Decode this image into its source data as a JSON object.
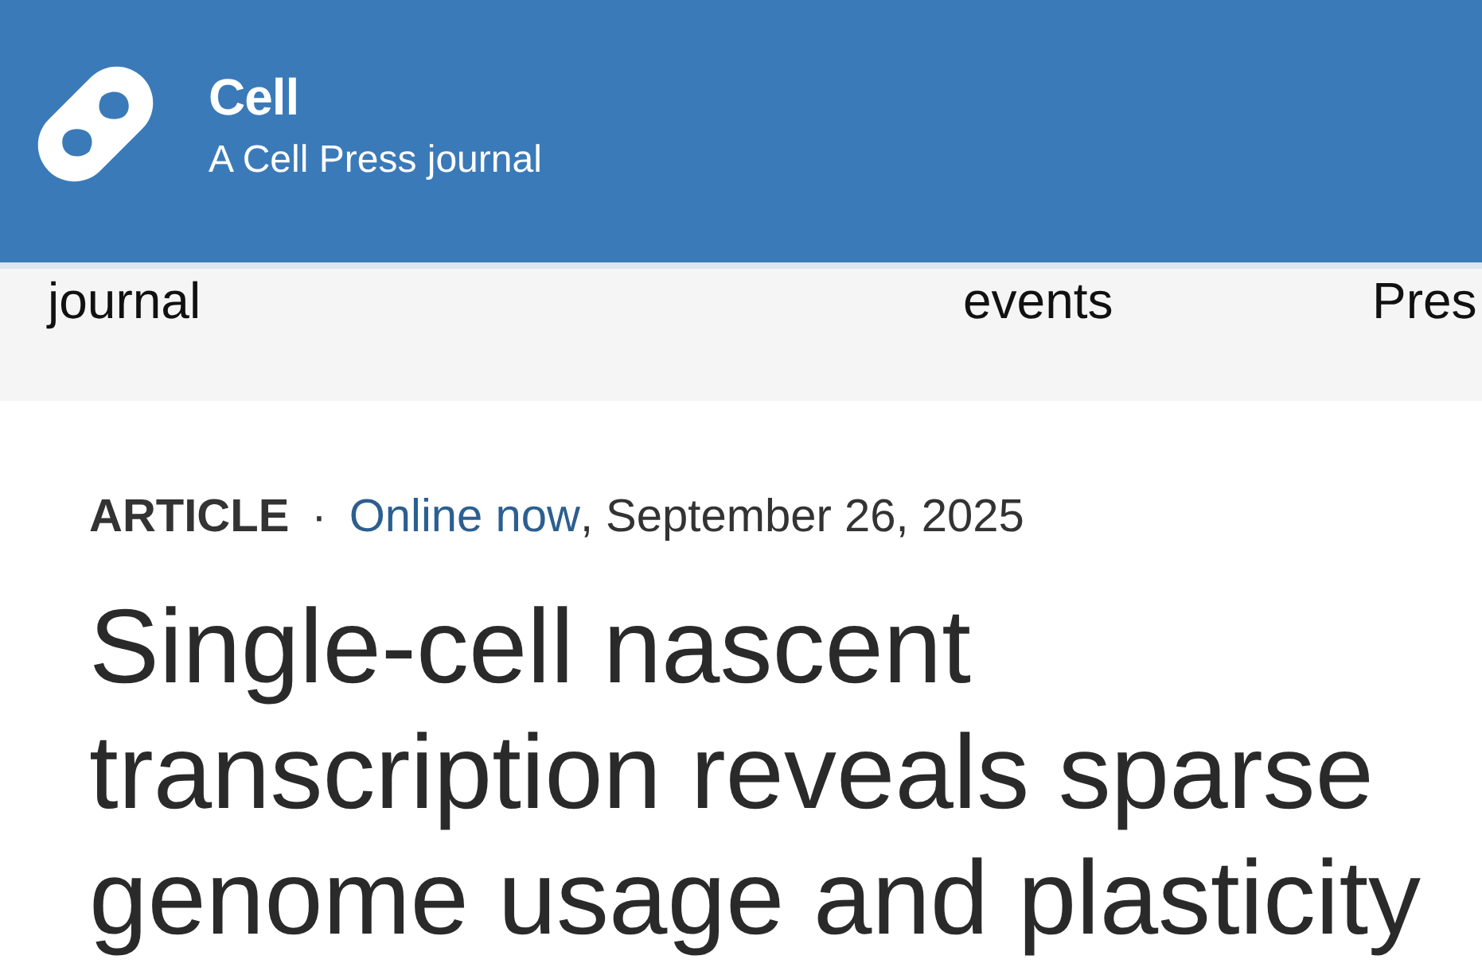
{
  "header": {
    "journal_name": "Cell",
    "tagline": "A Cell Press journal"
  },
  "nav": {
    "items": [
      {
        "label": "journal"
      },
      {
        "label": "events"
      },
      {
        "label": "Pres"
      }
    ]
  },
  "article": {
    "type_label": "ARTICLE",
    "separator": "·",
    "status_link": "Online now",
    "date": ", September 26, 2025",
    "title": "Single-cell nascent transcription reveals sparse genome usage and plasticity"
  }
}
